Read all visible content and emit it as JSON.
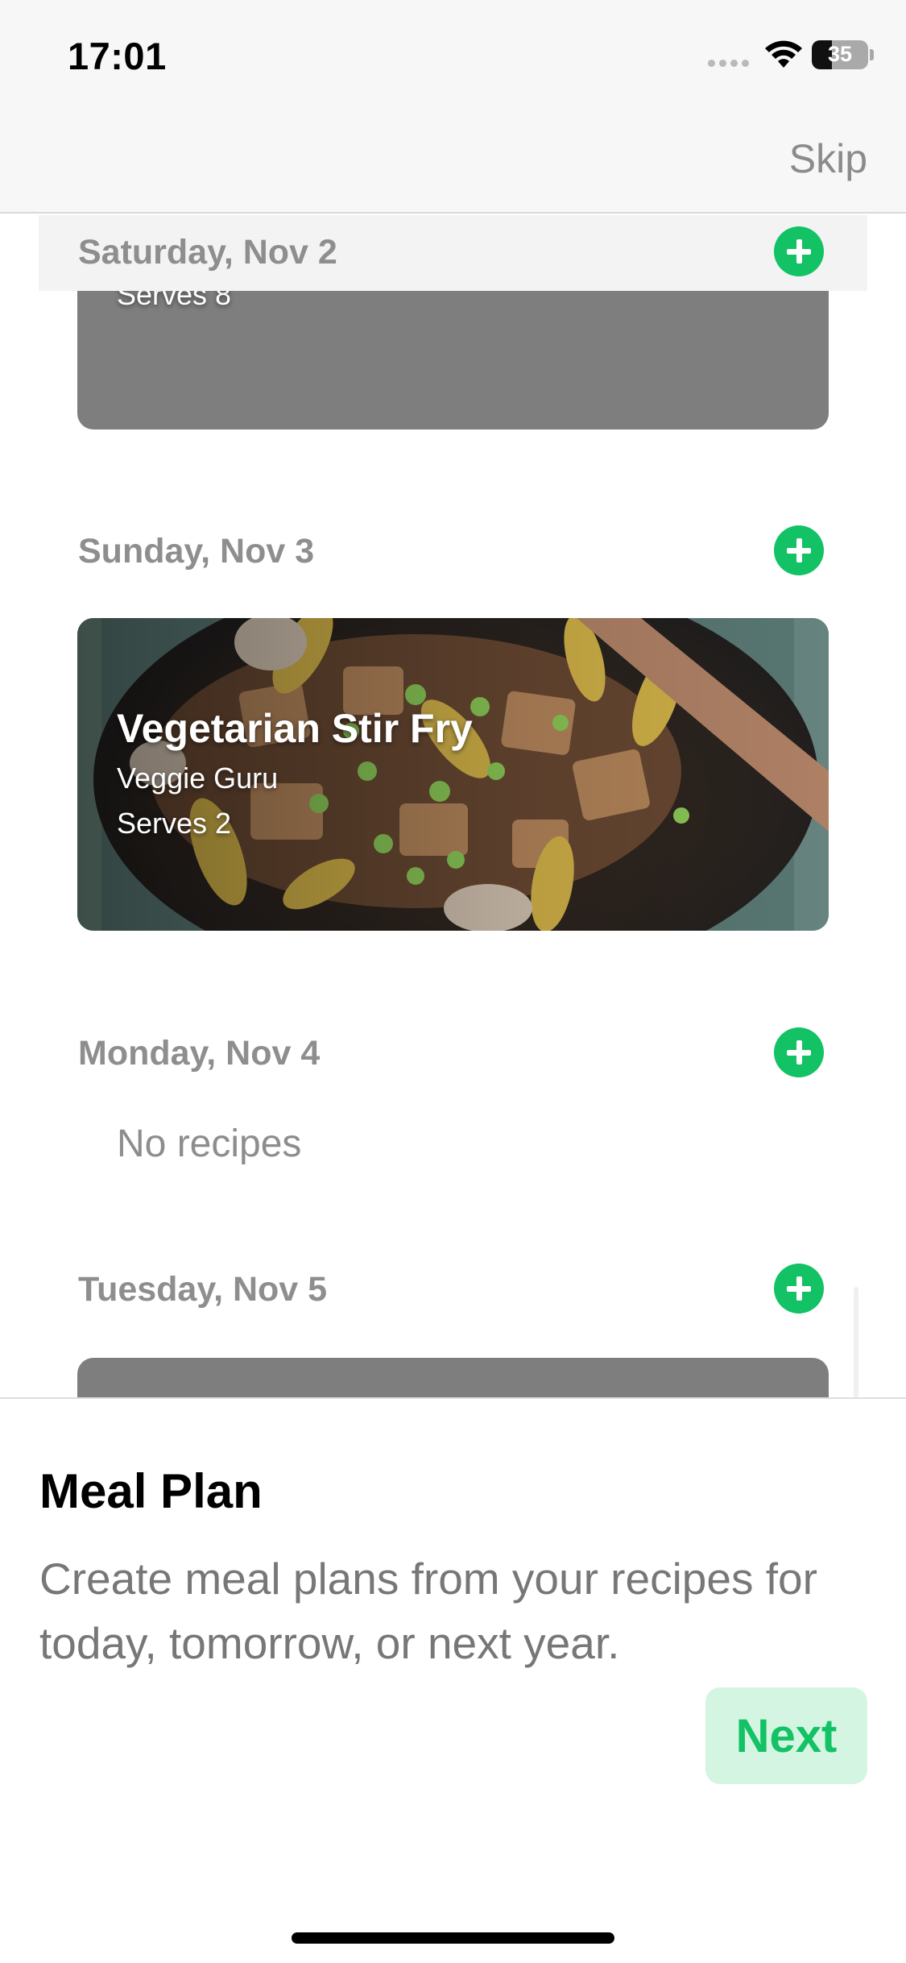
{
  "status_bar": {
    "time": "17:01",
    "battery_percent": "35",
    "battery_level": 0.35
  },
  "nav": {
    "skip_label": "Skip"
  },
  "days": [
    {
      "label": "Saturday, Nov 2",
      "recipe": {
        "serves": "Serves 8"
      }
    },
    {
      "label": "Sunday, Nov 3",
      "recipe": {
        "title": "Vegetarian Stir Fry",
        "author": "Veggie Guru",
        "serves": "Serves 2"
      }
    },
    {
      "label": "Monday, Nov 4",
      "empty_text": "No recipes"
    },
    {
      "label": "Tuesday, Nov 5"
    }
  ],
  "sheet": {
    "title": "Meal Plan",
    "description": "Create meal plans from your recipes for today, tomorrow, or next year.",
    "next_label": "Next"
  },
  "colors": {
    "accent": "#12c264",
    "accent_light": "#d4f5e2",
    "header_text": "#8e8e8e"
  },
  "icons": {
    "add": "plus-circle-icon",
    "wifi": "wifi-icon",
    "battery": "battery-icon"
  }
}
